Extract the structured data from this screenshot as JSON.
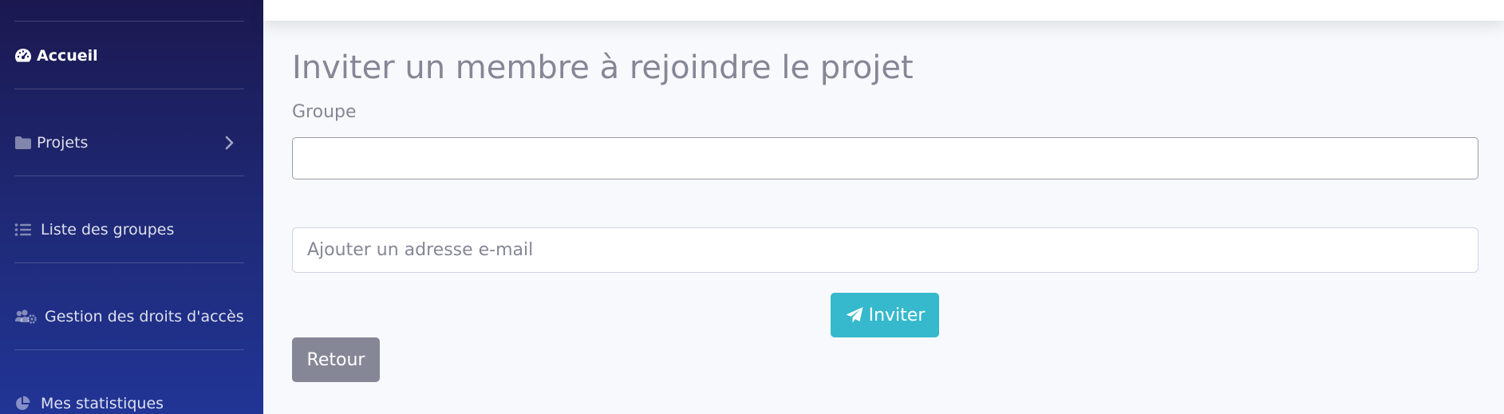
{
  "sidebar": {
    "items": [
      {
        "label": "Accueil",
        "icon": "tachometer-icon",
        "active": true
      },
      {
        "label": "Projets",
        "icon": "folder-icon",
        "has_submenu": true
      },
      {
        "label": "Liste des groupes",
        "icon": "list-icon"
      },
      {
        "label": "Gestion des droits d'accès",
        "icon": "users-cog-icon"
      },
      {
        "label": "Mes statistiques",
        "icon": "pie-chart-icon"
      }
    ]
  },
  "main": {
    "title": "Inviter un membre à rejoindre le projet",
    "group_label": "Groupe",
    "group_value": "",
    "email_placeholder": "Ajouter un adresse e-mail",
    "email_value": "",
    "invite_label": "Inviter",
    "back_label": "Retour"
  },
  "colors": {
    "sidebar_top": "#1b1850",
    "sidebar_bottom": "#213596",
    "invite_button": "#36b9cc",
    "back_button": "#858796",
    "background": "#f8f9fc"
  }
}
